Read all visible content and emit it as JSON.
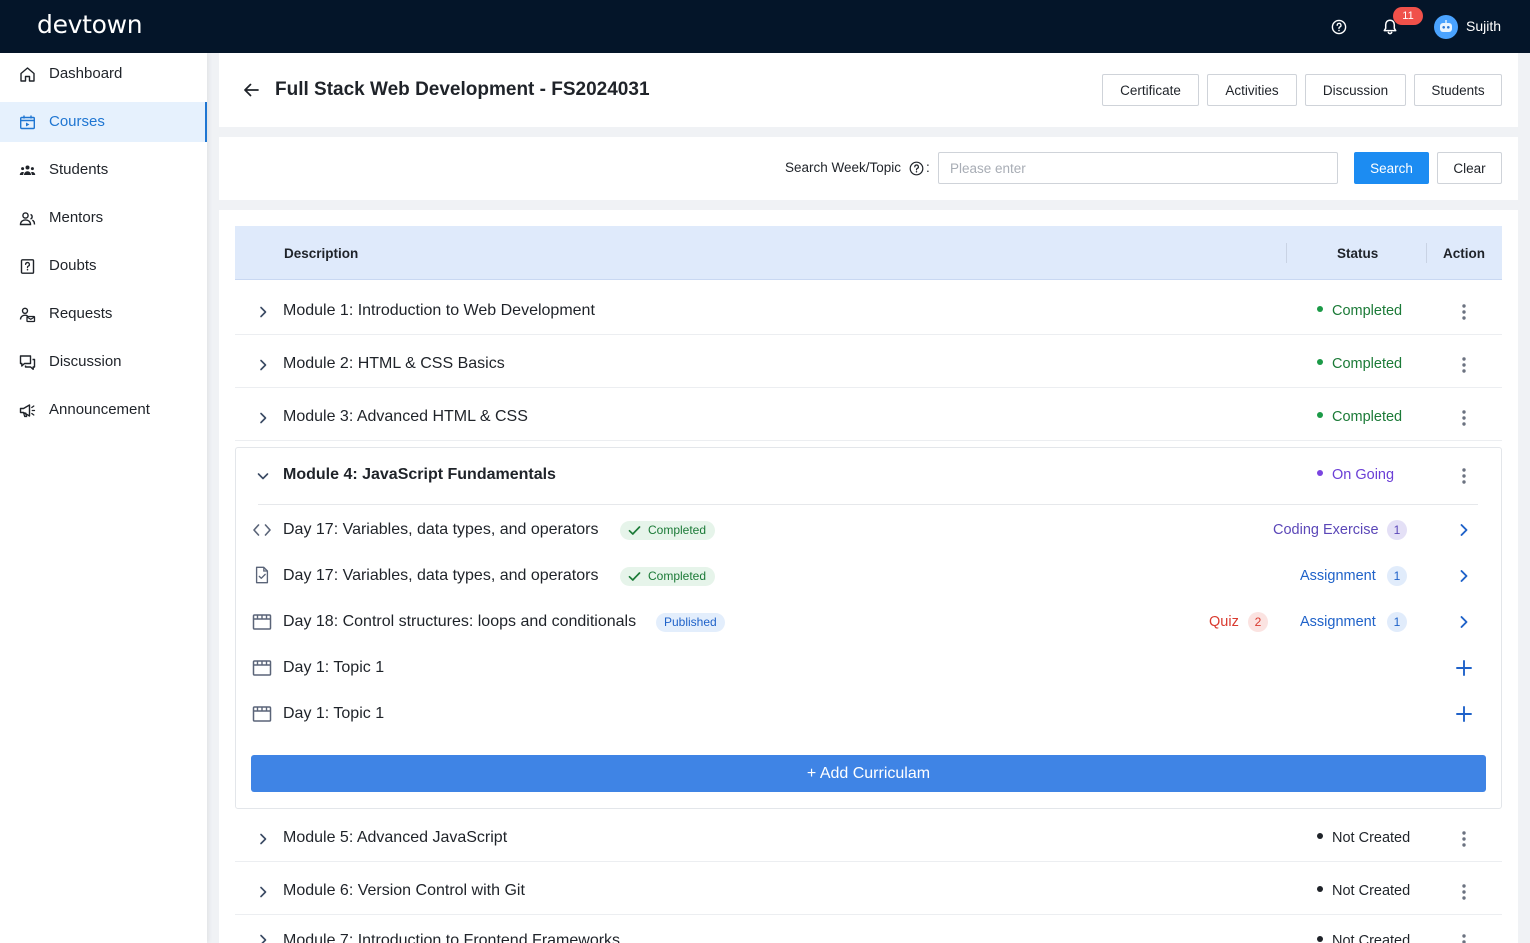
{
  "topbar": {
    "logo": "devtown",
    "notification_count": "11",
    "user_name": "Sujith"
  },
  "sidebar": {
    "items": [
      {
        "label": "Dashboard",
        "icon": "home-icon"
      },
      {
        "label": "Courses",
        "icon": "courses-icon",
        "active": true
      },
      {
        "label": "Students",
        "icon": "students-icon"
      },
      {
        "label": "Mentors",
        "icon": "mentors-icon"
      },
      {
        "label": "Doubts",
        "icon": "doubts-icon"
      },
      {
        "label": "Requests",
        "icon": "requests-icon"
      },
      {
        "label": "Discussion",
        "icon": "discussion-icon"
      },
      {
        "label": "Announcement",
        "icon": "megaphone-icon"
      }
    ]
  },
  "header": {
    "title": "Full Stack Web Development - FS2024031",
    "buttons": [
      "Certificate",
      "Activities",
      "Discussion",
      "Students"
    ]
  },
  "search": {
    "label": "Search Week/Topic",
    "placeholder": "Please enter",
    "value": "",
    "search_label": "Search",
    "clear_label": "Clear"
  },
  "table": {
    "columns": [
      "Description",
      "Status",
      "Action"
    ],
    "modules_before": [
      {
        "title": "Module 1: Introduction to Web Development",
        "status": "Completed"
      },
      {
        "title": "Module 2: HTML & CSS Basics",
        "status": "Completed"
      },
      {
        "title": "Module 3: Advanced HTML & CSS",
        "status": "Completed"
      }
    ],
    "expanded_module": {
      "title": "Module 4: JavaScript Fundamentals",
      "status": "On Going",
      "topics": [
        {
          "title": "Day 17: Variables, data types, and operators",
          "icon": "code-icon",
          "badge": "Completed",
          "links": [
            {
              "label": "Coding Exercise",
              "count": "1"
            }
          ]
        },
        {
          "title": "Day 17: Variables, data types, and operators",
          "icon": "assignment-doc-icon",
          "badge": "Completed",
          "links": [
            {
              "label": "Assignment",
              "count": "1"
            }
          ]
        },
        {
          "title": "Day 18: Control structures: loops and conditionals",
          "icon": "clapperboard-icon",
          "badge": "Published",
          "links": [
            {
              "label": "Quiz",
              "count": "2"
            },
            {
              "label": "Assignment",
              "count": "1"
            }
          ]
        },
        {
          "title": "Day 1: Topic 1",
          "icon": "clapperboard-icon"
        },
        {
          "title": "Day 1: Topic 1",
          "icon": "clapperboard-icon"
        }
      ],
      "add_label": "+ Add Curriculam"
    },
    "modules_after": [
      {
        "title": "Module 5: Advanced JavaScript",
        "status": "Not Created"
      },
      {
        "title": "Module 6: Version Control with Git",
        "status": "Not Created"
      },
      {
        "title": "Module 7: Introduction to Frontend Frameworks",
        "status": "Not Created"
      }
    ]
  },
  "colors": {
    "topbar": "#041529",
    "accent": "#1c8cf2",
    "completed": "#1b7a37",
    "ongoing": "#6b3fd6",
    "coding": "#5b47b8",
    "assignment": "#1f62c9",
    "quiz": "#d93a2f"
  }
}
